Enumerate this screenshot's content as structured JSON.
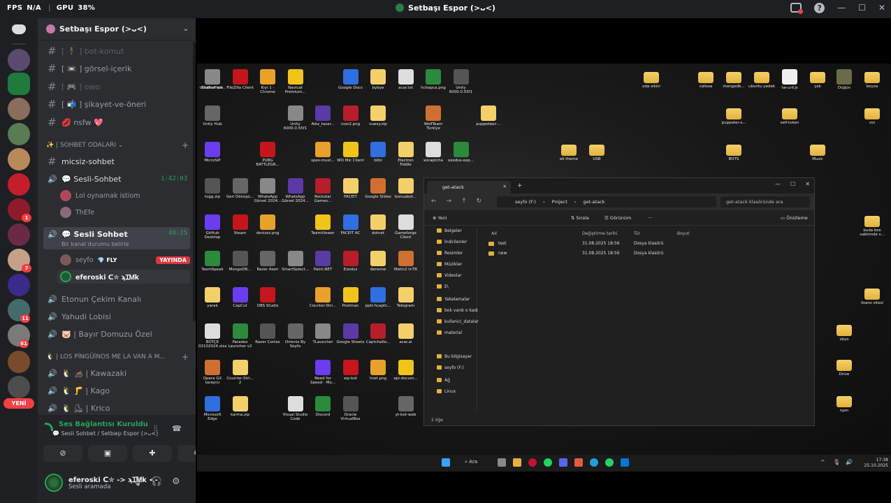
{
  "overlay": {
    "fps_label": "FPS",
    "fps_value": "N/A",
    "gpu_label": "GPU",
    "gpu_value": "38%"
  },
  "window": {
    "title": "Setbaşı Espor (>ᴗ<)"
  },
  "servers": {
    "new_label": "YENİ",
    "badges": [
      "1",
      "7",
      "11",
      "61"
    ]
  },
  "guild": {
    "name": "Setbaşı Espor (>ᴗ<)"
  },
  "channels": {
    "text": [
      {
        "name": "[ 🕴 ] bot-komut"
      },
      {
        "name": "[ 📼 ] görsel-içerik"
      },
      {
        "name": "[ 🎮 ] owo"
      },
      {
        "name": "[ 📬 ] şikayet-ve-öneri"
      },
      {
        "name": "💋 nsfw 💖"
      }
    ],
    "category1": "✨ | SOHBET ODALARI",
    "micsiz": "micsiz-sohbet",
    "voice1": {
      "name": "💬 Sesli-Sohbet",
      "time": "1:42:03"
    },
    "voice1_users": [
      "Lol oynamak istiom",
      "ThEfe"
    ],
    "voice2": {
      "name": "💬 Sesli Sohbet",
      "time": "40:25",
      "status": "Bir kanal durumu belirle"
    },
    "voice2_users": [
      {
        "name": "seyfo",
        "tag": "💎 FLY",
        "badge": "YAYINDA"
      },
      {
        "name": "eferoski ᑕ✮ ϡꞮᎷk"
      }
    ],
    "voice_more": [
      "Etonun Çekim Kanalı",
      "Yahudi Lobisi",
      "🐷 | Bayır Domuzu Özel"
    ],
    "category2": "🐧 | LOS PİNGÜİNOS ME LA VAN A M...",
    "voice_p": [
      "🐧 🦽 | Kawazaki",
      "🐧 🦵 | Kago",
      "🐧 ⛸ | Krico"
    ]
  },
  "voice_panel": {
    "title": "Ses Bağlantısı Kuruldu",
    "subtitle": "💬 Sesli Sohbet / Setbaşı Espor (>ᴗ<)"
  },
  "me": {
    "name": "eferoski ᑕ✮ -> ϡꞮᎷk <-",
    "status": "Sesli aramada"
  },
  "desktop_icons": [
    "FlutterFlow",
    "FileZilla Client",
    "Kiyi 1 - Chrome",
    "Navicat Premium...",
    "Google Docs",
    "bybye",
    "acar.txt",
    "hchapca.png",
    "Unity 6000.0.55f1",
    "Unity Hub",
    "Unity 6000.0.55f1",
    "Adız_tasar...",
    "icon2.png",
    "vuexy.zip",
    "WolfTeam Türkiye",
    "puppeteer-...",
    "MicroSIP",
    "PUBG BATTLEGR...",
    "spes-must...",
    "WO Mic Client",
    "blitz",
    "Electron Fiddle",
    "wicaptcha",
    "exodus-exp...",
    "togg.zip",
    "Geri Dönüşü...",
    "WhatsApp Görsel 2024...",
    "WhatsApp Görsel 2024...",
    "Rockstar Games...",
    "FACEIT",
    "Google Slides",
    "bonusbot...",
    "GitHub Desktop",
    "Steam",
    "denizzz.png",
    "TeamViewer",
    "FACEIT AC",
    "dotnet",
    "Gameforge Client",
    "TeamSpeak",
    "MongoDB...",
    "Razer Axon",
    "SmartSelect...",
    "Paint.NET",
    "Exodus",
    "deneme",
    "Metin2 tr-TR",
    "yarak",
    "CapCut",
    "OBS Studio",
    "Counter-Stri...",
    "Postman",
    "pptr-hcaptc...",
    "Telegram",
    "BÜTÇE 02102024.xlsx",
    "Paradox Launcher v2",
    "Razer Cortex",
    "Onionis By Seyfo",
    "TLauncher",
    "Google Sheets",
    "Captchallo...",
    "acar.ai",
    "Opera GX tarayıcı",
    "Counter-Stri... 2",
    "Need for Speed - Mo...",
    "wp-bot",
    "host.png",
    "api-docum...",
    "Microsoft Edge",
    "karma.zip",
    "Visual Studio Code",
    "Discord",
    "Oracle VirtualBox",
    "yt-bot-web",
    "duraflux-ad...",
    "oda sikici",
    "calissa",
    "mongodb...",
    "ubuntu yedek",
    "tw-unf.js",
    "çek",
    "Düğün",
    "beyza",
    "puppeter-s...",
    "self-token",
    "voi",
    "ek theme",
    "USB",
    "BOTS",
    "Music",
    "buda bos vaktimde s...",
    "lisans sitesi",
    "okyo",
    "Drive",
    "npm"
  ],
  "explorer": {
    "tab": "get-atack",
    "path": [
      "seyfo (F:)",
      "Project",
      "get-atack"
    ],
    "search": "get-atack klasöründe ara",
    "toolbar": {
      "new": "Yeni",
      "sort": "Sırala",
      "view": "Görünüm",
      "preview": "Önizleme"
    },
    "sidebar": [
      "Belgeler",
      "İndirilenler",
      "Resimler",
      "Müzikler",
      "Videolar",
      "E\\",
      "Yakalamalar",
      "bok vardı o kadı",
      "kullanici_datalar",
      "material",
      "Bu bilgisayar",
      "seyfo (F:)",
      "Ağ",
      "Linux"
    ],
    "columns": [
      "Ad",
      "Değiştirme tarihi",
      "Tür",
      "Boyut"
    ],
    "rows": [
      {
        "name": "test",
        "date": "31.08.2025 18:56",
        "type": "Dosya klasörü"
      },
      {
        "name": "new",
        "date": "31.08.2025 18:56",
        "type": "Dosya klasörü"
      }
    ],
    "status": "2 öğe"
  },
  "taskbar": {
    "search": "Ara",
    "time": "17:38",
    "date": "25.10.2025"
  }
}
